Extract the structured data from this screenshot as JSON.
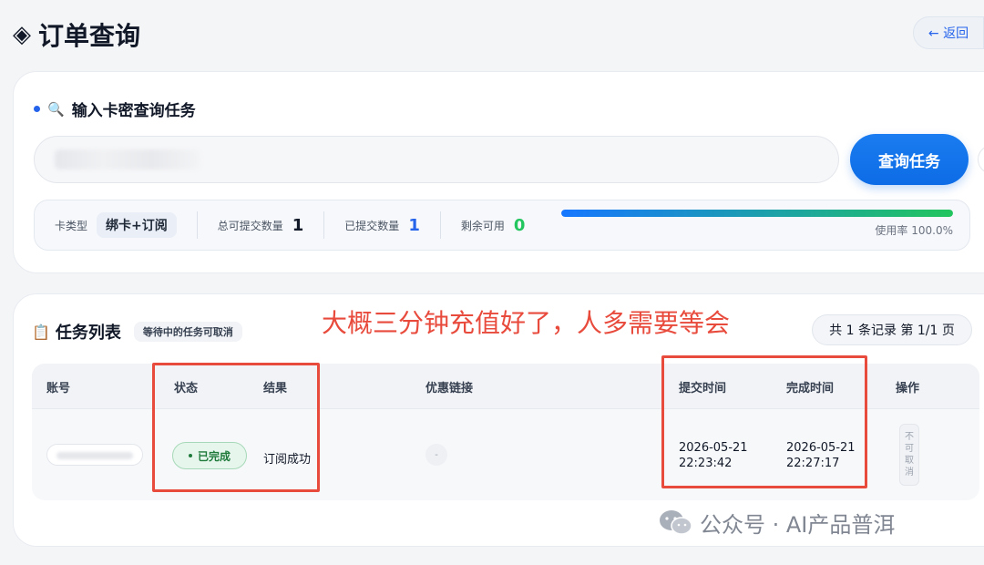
{
  "header": {
    "title": "订单查询",
    "title_icon": "◈",
    "back_label": "← 返回"
  },
  "query": {
    "section_title": "输入卡密查询任务",
    "input_value": "",
    "button_label": "查询任务"
  },
  "stats": {
    "card_type_label": "卡类型",
    "card_type_value": "绑卡+订阅",
    "total_label": "总可提交数量",
    "total_value": "1",
    "submitted_label": "已提交数量",
    "submitted_value": "1",
    "remaining_label": "剩余可用",
    "remaining_value": "0",
    "usage_text": "使用率 100.0%",
    "usage_fraction": 1.0
  },
  "tasks": {
    "title": "任务列表",
    "cancel_hint": "等待中的任务可取消",
    "annotation": "大概三分钟充值好了，人多需要等会",
    "record_summary": "共 1 条记录 第 1/1 页",
    "columns": [
      "账号",
      "状态",
      "结果",
      "优惠链接",
      "提交时间",
      "完成时间",
      "操作"
    ],
    "rows": [
      {
        "status": "已完成",
        "result": "订阅成功",
        "coupon": "-",
        "submit_date": "2026-05-21",
        "submit_time": "22:23:42",
        "complete_date": "2026-05-21",
        "complete_time": "22:27:17",
        "action_chars": [
          "不",
          "可",
          "取",
          "消"
        ]
      }
    ]
  },
  "watermark": {
    "text": "公众号 · AI产品普洱"
  },
  "colors": {
    "accent": "#2563eb",
    "annotation": "#e84a3c",
    "success": "#22c55e"
  }
}
